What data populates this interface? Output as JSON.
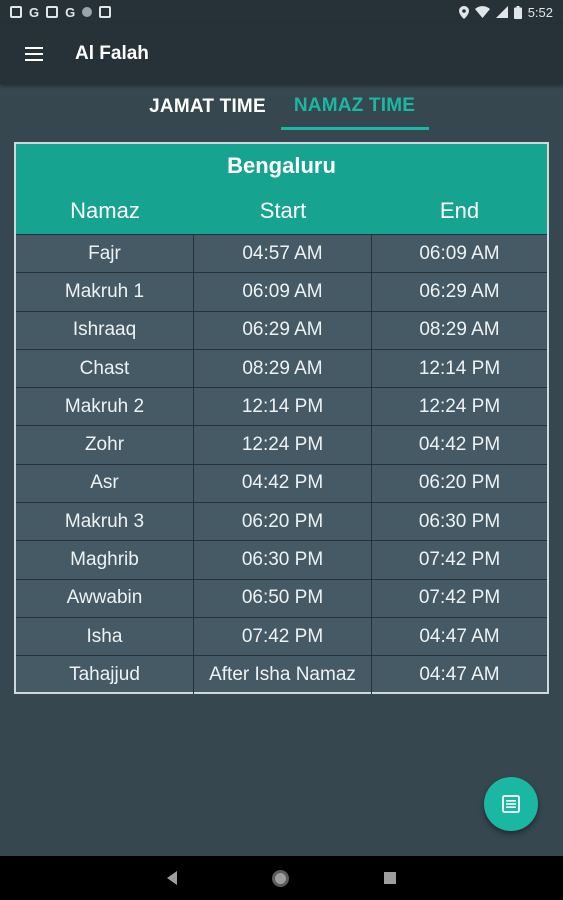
{
  "status_bar": {
    "notification_icons": [
      "G",
      "G"
    ],
    "time": "5:52"
  },
  "app_bar": {
    "title": "Al Falah",
    "menu_icon": "hamburger-menu-icon"
  },
  "tabs": [
    {
      "label": "JAMAT TIME",
      "active": false
    },
    {
      "label": "NAMAZ TIME",
      "active": true
    }
  ],
  "colors": {
    "accent": "#1ab8a3",
    "header_bg": "#16a390",
    "background": "#37474f",
    "appbar": "#263238"
  },
  "table": {
    "city": "Bengaluru",
    "headers": [
      "Namaz",
      "Start",
      "End"
    ],
    "rows": [
      [
        "Fajr",
        "04:57 AM",
        "06:09 AM"
      ],
      [
        "Makruh 1",
        "06:09 AM",
        "06:29 AM"
      ],
      [
        "Ishraaq",
        "06:29 AM",
        "08:29 AM"
      ],
      [
        "Chast",
        "08:29 AM",
        "12:14 PM"
      ],
      [
        "Makruh 2",
        "12:14 PM",
        "12:24 PM"
      ],
      [
        "Zohr",
        "12:24 PM",
        "04:42 PM"
      ],
      [
        "Asr",
        "04:42 PM",
        "06:20 PM"
      ],
      [
        "Makruh 3",
        "06:20 PM",
        "06:30 PM"
      ],
      [
        "Maghrib",
        "06:30 PM",
        "07:42 PM"
      ],
      [
        "Awwabin",
        "06:50 PM",
        "07:42 PM"
      ],
      [
        "Isha",
        "07:42 PM",
        "04:47 AM"
      ],
      [
        "Tahajjud",
        "After Isha Namaz",
        "04:47 AM"
      ]
    ]
  },
  "fab": {
    "icon": "list-document-icon"
  }
}
